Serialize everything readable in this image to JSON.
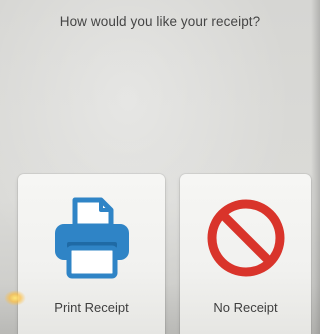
{
  "prompt": {
    "text": "How would you like your receipt?"
  },
  "options": [
    {
      "label": "Print Receipt",
      "icon": "printer-icon",
      "color": "#2f84c6"
    },
    {
      "label": "No Receipt",
      "icon": "no-symbol-icon",
      "color": "#d9342b"
    }
  ]
}
